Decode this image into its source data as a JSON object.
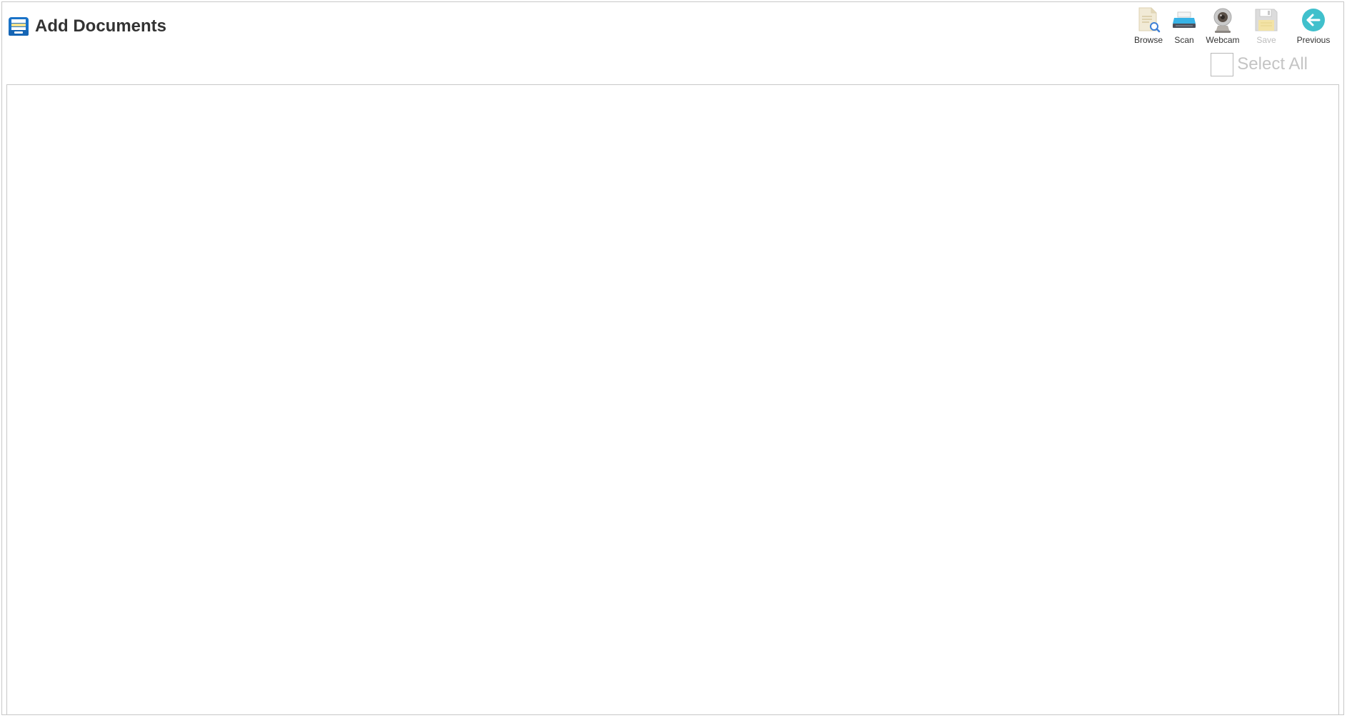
{
  "header": {
    "title": "Add Documents",
    "icon": "document-tray-icon"
  },
  "toolbar": {
    "items": [
      {
        "label": "Browse",
        "icon": "browse-document-icon",
        "enabled": true
      },
      {
        "label": "Scan",
        "icon": "scanner-icon",
        "enabled": true
      },
      {
        "label": "Webcam",
        "icon": "webcam-icon",
        "enabled": true
      },
      {
        "label": "Save",
        "icon": "floppy-disk-icon",
        "enabled": false
      },
      {
        "label": "Previous",
        "icon": "arrow-left-circle-icon",
        "enabled": true
      }
    ]
  },
  "select_all": {
    "label": "Select All",
    "checked": false
  },
  "documents": [],
  "colors": {
    "accent_teal": "#40c0cc",
    "accent_blue": "#1a73c8",
    "disabled_text": "#bdbdbd",
    "border": "#c8c8c8"
  }
}
